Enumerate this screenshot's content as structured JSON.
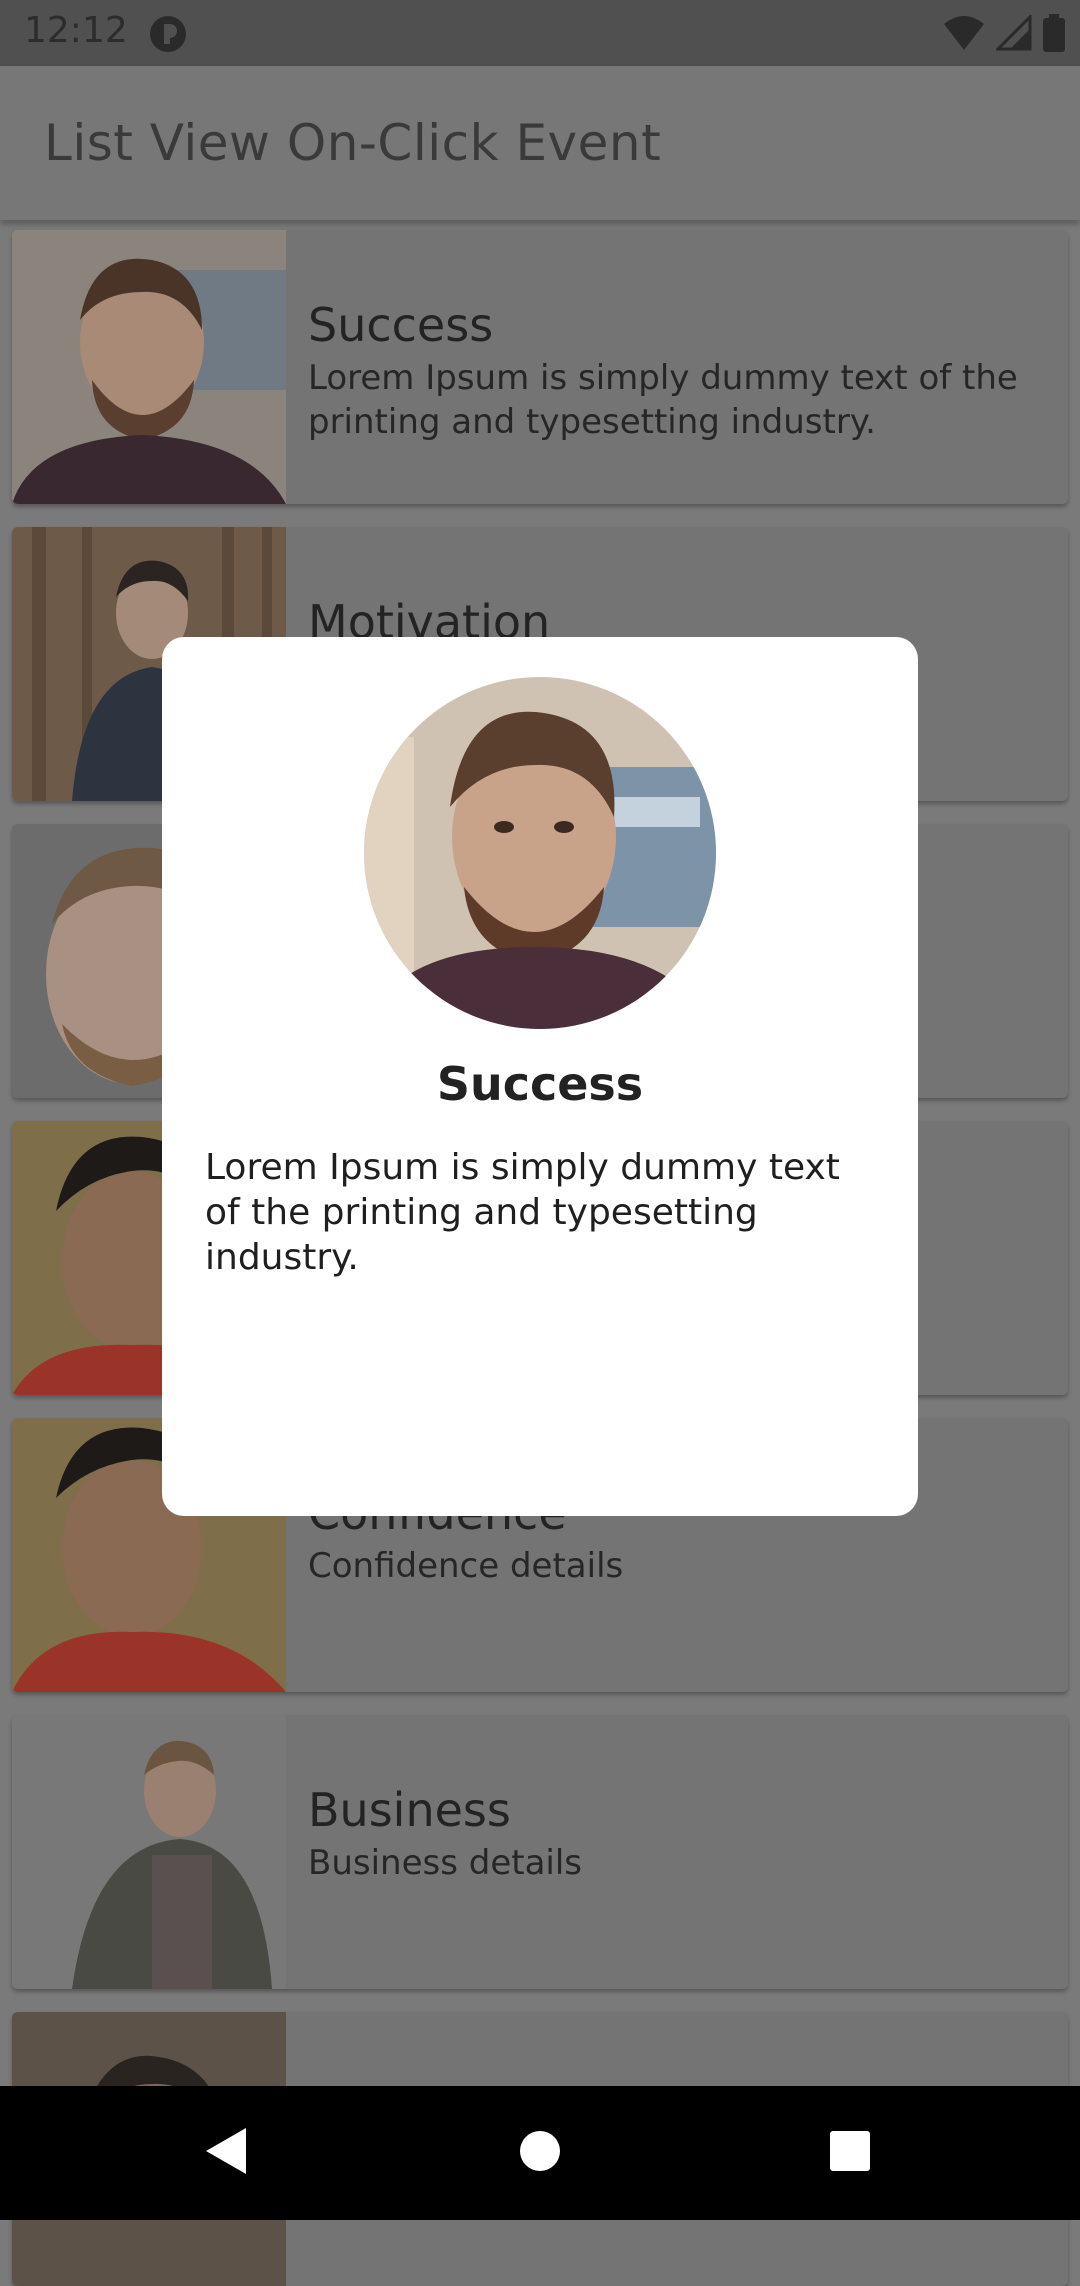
{
  "status_bar": {
    "time": "12:12"
  },
  "app_bar": {
    "title": "List View On-Click Event"
  },
  "list": {
    "items": [
      {
        "title": "Success",
        "subtitle": "Lorem Ipsum is simply dummy text of the printing and typesetting industry."
      },
      {
        "title": "Motivation",
        "subtitle": ""
      },
      {
        "title": "",
        "subtitle": ""
      },
      {
        "title": "",
        "subtitle": ""
      },
      {
        "title": "Confidence",
        "subtitle": "Confidence details"
      },
      {
        "title": "Business",
        "subtitle": "Business details"
      },
      {
        "title": "",
        "subtitle": ""
      }
    ]
  },
  "dialog": {
    "title": "Success",
    "text": "Lorem Ipsum is simply dummy text of the printing and typesetting industry."
  },
  "nav": {
    "back_icon": "back-icon",
    "home_icon": "home-icon",
    "recents_icon": "recents-icon"
  },
  "colors": {
    "scrim": "#7a7a7a",
    "dialog_bg": "#ffffff",
    "nav_bg": "#000000"
  }
}
